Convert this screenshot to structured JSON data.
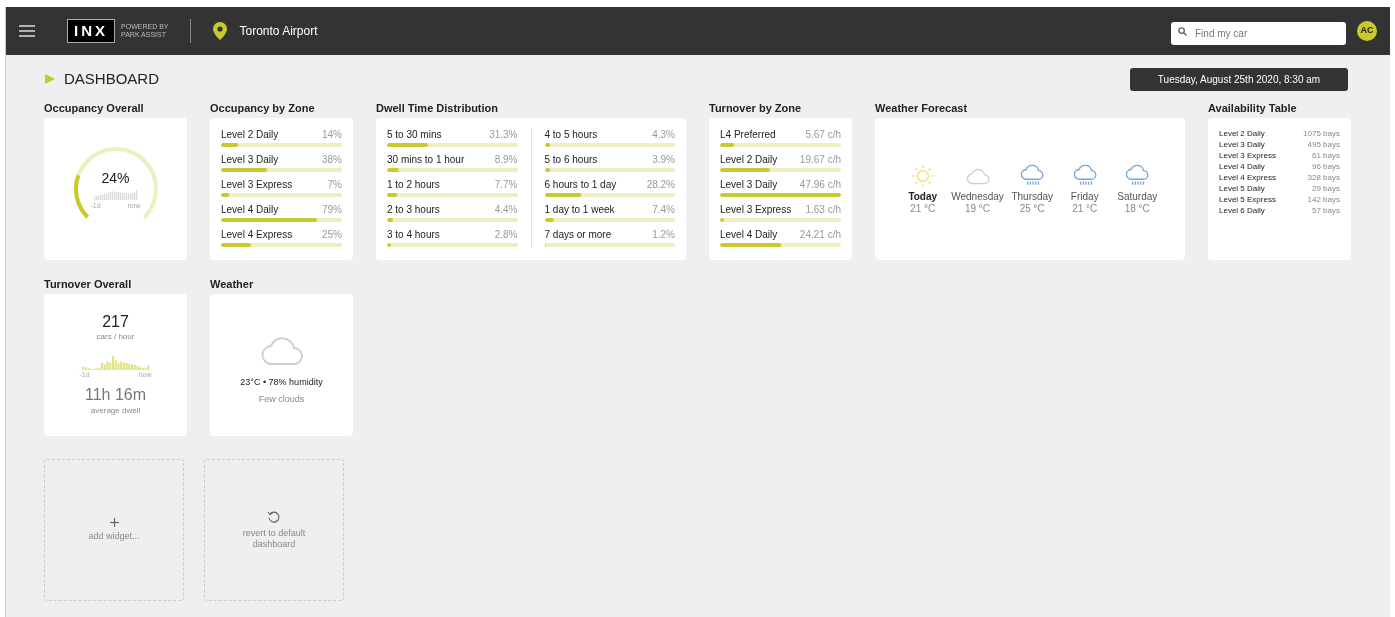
{
  "header": {
    "logo": "INX",
    "logo_tagline": [
      "POWERED BY",
      "PARK ASSIST"
    ],
    "location": "Toronto Airport",
    "search": {
      "placeholder": "Find my car"
    },
    "avatar": "AC"
  },
  "page": {
    "title": "DASHBOARD",
    "date": "Tuesday, August 25th 2020, 8:30 am"
  },
  "occupancy_overall": {
    "title": "Occupancy Overall",
    "value": "24%",
    "axis": [
      "-1d",
      "now"
    ]
  },
  "occupancy_by_zone": {
    "title": "Occupancy by Zone",
    "rows": [
      {
        "label": "Level 2 Daily",
        "value": "14%",
        "level": 0.14
      },
      {
        "label": "Level 3 Daily",
        "value": "38%",
        "level": 0.38
      },
      {
        "label": "Level 3 Express",
        "value": "7%",
        "level": 0.07
      },
      {
        "label": "Level 4 Daily",
        "value": "79%",
        "level": 0.79
      },
      {
        "label": "Level 4 Express",
        "value": "25%",
        "level": 0.25
      }
    ]
  },
  "dwell_time_distribution": {
    "title": "Dwell Time Distribution",
    "columns": [
      [
        {
          "label": "5 to 30 mins",
          "value": "31.3%",
          "level": 0.313
        },
        {
          "label": "30 mins to 1 hour",
          "value": "8.9%",
          "level": 0.089
        },
        {
          "label": "1 to 2 hours",
          "value": "7.7%",
          "level": 0.077
        },
        {
          "label": "2 to 3 hours",
          "value": "4.4%",
          "level": 0.044
        },
        {
          "label": "3 to 4 hours",
          "value": "2.8%",
          "level": 0.028
        }
      ],
      [
        {
          "label": "4 to 5 hours",
          "value": "4.3%",
          "level": 0.043
        },
        {
          "label": "5 to 6 hours",
          "value": "3.9%",
          "level": 0.039
        },
        {
          "label": "6 hours to 1 day",
          "value": "28.2%",
          "level": 0.282
        },
        {
          "label": "1 day to 1 week",
          "value": "7.4%",
          "level": 0.074
        },
        {
          "label": "7 days or more",
          "value": "1.2%",
          "level": 0.012
        }
      ]
    ]
  },
  "turnover_by_zone": {
    "title": "Turnover by Zone",
    "rows": [
      {
        "label": "L4 Preferred",
        "value": "5.67 c/h",
        "level": 0.118
      },
      {
        "label": "Level 2 Daily",
        "value": "19.67 c/h",
        "level": 0.41
      },
      {
        "label": "Level 3 Daily",
        "value": "47.96 c/h",
        "level": 1
      },
      {
        "label": "Level 3 Express",
        "value": "1.63 c/h",
        "level": 0.034
      },
      {
        "label": "Level 4 Daily",
        "value": "24.21 c/h",
        "level": 0.505
      }
    ]
  },
  "weather_forecast": {
    "title": "Weather Forecast",
    "days": [
      {
        "day": "Today",
        "temp": "21 °C",
        "kind": "sun",
        "selected": true
      },
      {
        "day": "Wednesday",
        "temp": "19 °C",
        "kind": "cloud",
        "selected": false
      },
      {
        "day": "Thursday",
        "temp": "25 °C",
        "kind": "rain",
        "selected": false
      },
      {
        "day": "Friday",
        "temp": "21 °C",
        "kind": "rain",
        "selected": false
      },
      {
        "day": "Saturday",
        "temp": "18 °C",
        "kind": "rain",
        "selected": false
      }
    ]
  },
  "availability_table": {
    "title": "Availability Table",
    "rows": [
      {
        "zone": "Level 2 Daily",
        "bays": "1075 bays"
      },
      {
        "zone": "Level 3 Daily",
        "bays": "495 bays"
      },
      {
        "zone": "Level 3 Express",
        "bays": "61 bays"
      },
      {
        "zone": "Level 4 Daily",
        "bays": "96 bays"
      },
      {
        "zone": "Level 4 Express",
        "bays": "328 bays"
      },
      {
        "zone": "Level 5 Daily",
        "bays": "29 bays"
      },
      {
        "zone": "Level 5 Express",
        "bays": "142 bays"
      },
      {
        "zone": "Level 6 Daily",
        "bays": "57 bays"
      }
    ]
  },
  "turnover_overall": {
    "title": "Turnover Overall",
    "value": "217",
    "unit": "cars / hour",
    "axis": [
      "-1d",
      "now"
    ],
    "dwell": "11h 16m",
    "dwell_label": "average dwell"
  },
  "weather": {
    "title": "Weather",
    "summary": "23°C • 78% humidity",
    "condition": "Few clouds"
  },
  "actions": [
    {
      "kind": "add",
      "label": "add widget..."
    },
    {
      "kind": "revert",
      "label": "revert to default dashboard"
    }
  ]
}
